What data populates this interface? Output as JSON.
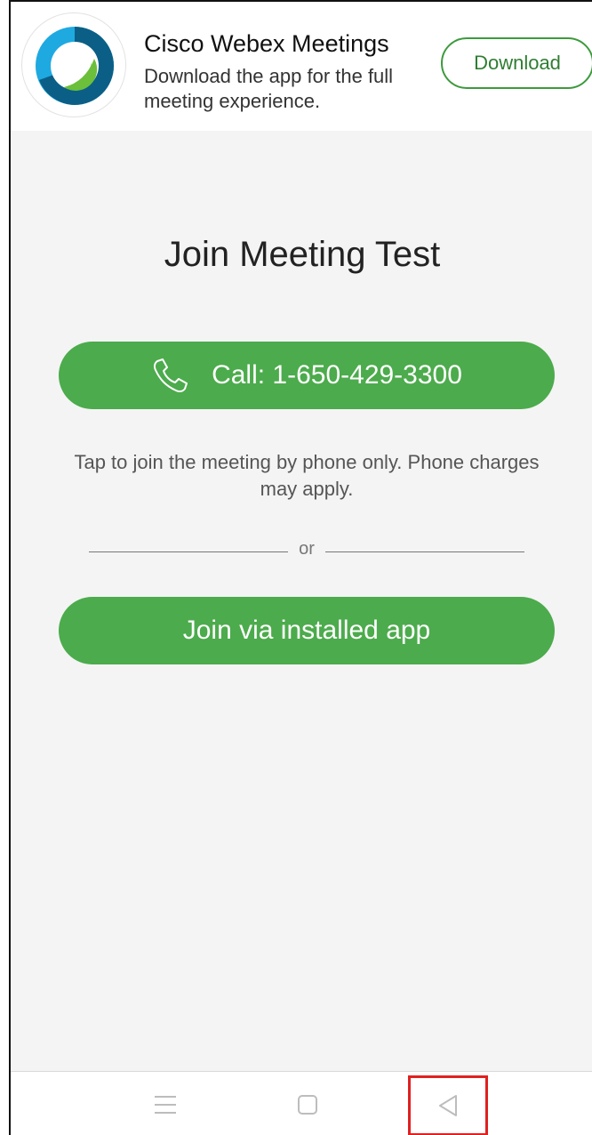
{
  "banner": {
    "app_name": "Cisco Webex Meetings",
    "description": "Download the app for the full meeting experience.",
    "download_label": "Download",
    "icon": "webex-logo-icon"
  },
  "page": {
    "title": "Join Meeting Test",
    "call_button_label": "Call: 1-650-429-3300",
    "call_icon": "phone-icon",
    "phone_note": "Tap to join the meeting by phone only. Phone charges may apply.",
    "divider_text": "or",
    "join_app_label": "Join via installed app"
  },
  "navbar": {
    "items": [
      "menu-icon",
      "home-icon",
      "back-icon"
    ]
  },
  "colors": {
    "accent_green": "#4cab4c",
    "download_border": "#3d9a3d",
    "highlight_red": "#e02020"
  }
}
